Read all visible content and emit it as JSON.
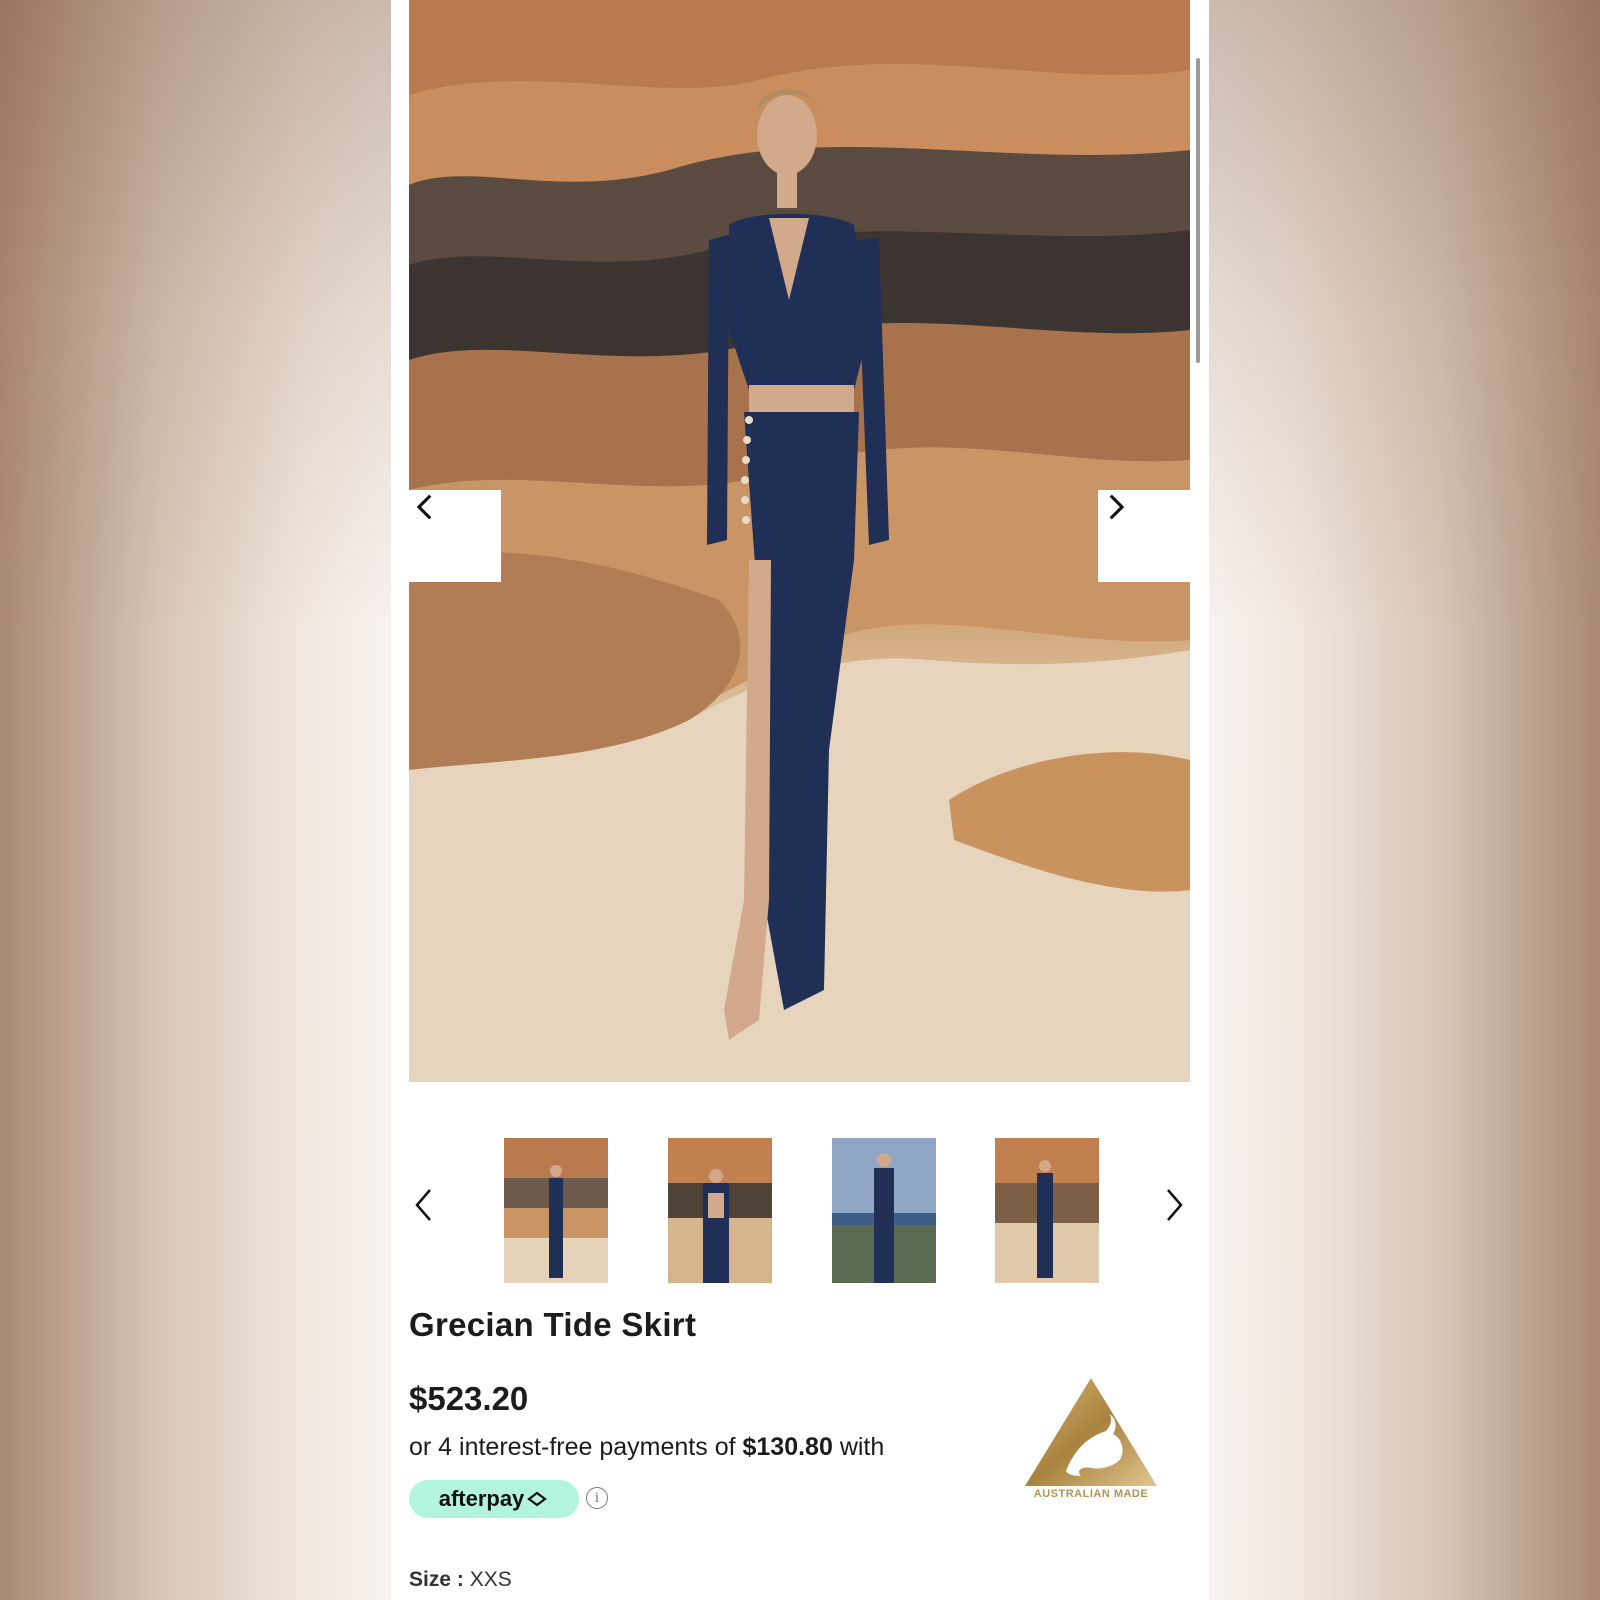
{
  "product": {
    "title": "Grecian Tide Skirt",
    "price": "$523.20",
    "installments": {
      "prefix": "or 4 interest-free payments of",
      "amount": "$130.80",
      "suffix": "with"
    },
    "afterpay_label": "afterpay",
    "info_glyph": "i",
    "badge_text": "AUSTRALIAN MADE",
    "size": {
      "label": "Size :",
      "value": "XXS"
    }
  },
  "gallery": {
    "main_image": "model-in-navy-two-piece-on-sandstone-beach",
    "thumbnails": [
      "front-view",
      "back-view",
      "front-view-ocean",
      "back-view-side"
    ],
    "icons": {
      "prev": "chevron-left-icon",
      "next": "chevron-right-icon"
    }
  },
  "colors": {
    "afterpay": "#b2f5dc",
    "navy": "#1f2f55",
    "badge_gold": "#b49256"
  }
}
